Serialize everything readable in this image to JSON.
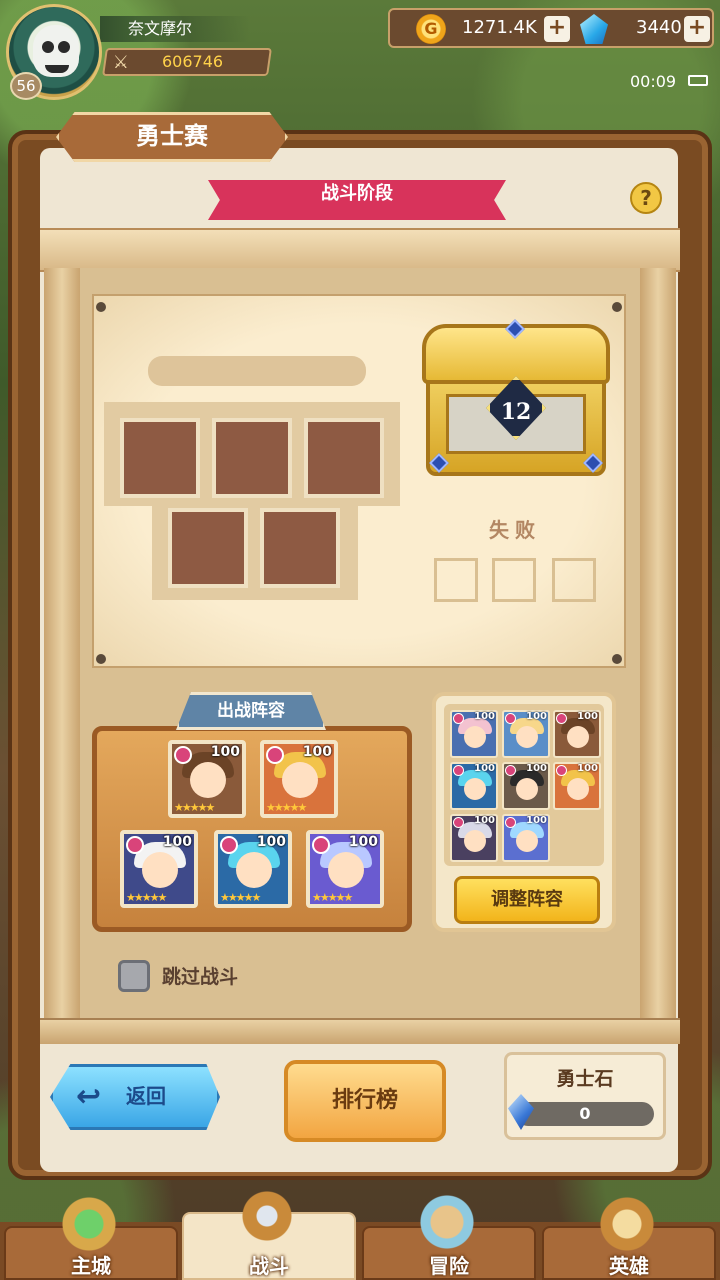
{
  "player": {
    "name": "奈文摩尔",
    "level": "56",
    "power": "606746"
  },
  "resources": {
    "gold": "1271.4K",
    "gems": "3440",
    "plus": "+"
  },
  "status": {
    "time": "00:09"
  },
  "header": {
    "title": "勇士赛",
    "stage": "战斗阶段",
    "help": "?"
  },
  "chest": {
    "number": "12",
    "result": "失败"
  },
  "lineup": {
    "title": "出战阵容",
    "heroes": [
      {
        "level": "100",
        "bg": "#8a5a3a",
        "hair": "#6b4326"
      },
      {
        "level": "100",
        "bg": "#d9733c",
        "hair": "#f2c34a"
      },
      {
        "level": "100",
        "bg": "#3f4a8a",
        "hair": "#f3f3f3"
      },
      {
        "level": "100",
        "bg": "#2b6aa6",
        "hair": "#5ad4ee"
      },
      {
        "level": "100",
        "bg": "#6a5bd0",
        "hair": "#b9c8ff"
      }
    ]
  },
  "roster": {
    "heroes": [
      {
        "level": "100",
        "bg": "#4a6fb0",
        "hair": "#f3c2d0"
      },
      {
        "level": "100",
        "bg": "#5a8ec8",
        "hair": "#f7d78a"
      },
      {
        "level": "100",
        "bg": "#8a5a3a",
        "hair": "#6b4326"
      },
      {
        "level": "100",
        "bg": "#2b6aa6",
        "hair": "#5ad4ee"
      },
      {
        "level": "100",
        "bg": "#6b5a4a",
        "hair": "#2a2a2a"
      },
      {
        "level": "100",
        "bg": "#d9733c",
        "hair": "#f2c34a"
      },
      {
        "level": "100",
        "bg": "#4a4060",
        "hair": "#d9d9e8"
      },
      {
        "level": "100",
        "bg": "#5b6fd0",
        "hair": "#9fd8ff"
      }
    ],
    "adjust_label": "调整阵容"
  },
  "skip": {
    "label": "跳过战斗"
  },
  "actions": {
    "back_label": "返回",
    "back_icon": "↩",
    "ranking_label": "排行榜"
  },
  "stone": {
    "title": "勇士石",
    "value": "0"
  },
  "nav": {
    "items": [
      {
        "label": "主城",
        "icon": "castle-icon"
      },
      {
        "label": "战斗",
        "icon": "crossed-swords-icon"
      },
      {
        "label": "冒险",
        "icon": "scroll-map-icon"
      },
      {
        "label": "英雄",
        "icon": "hero-crest-icon"
      }
    ]
  }
}
